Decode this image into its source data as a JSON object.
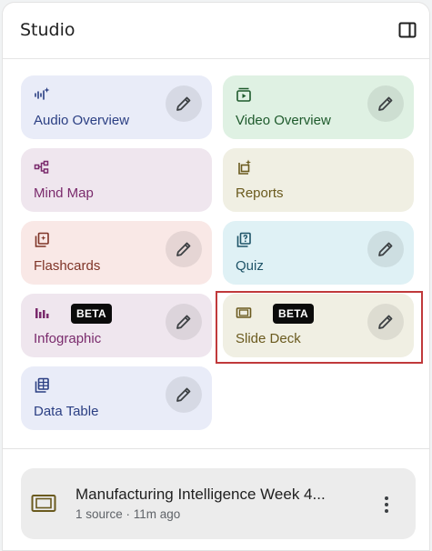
{
  "header": {
    "title": "Studio",
    "collapse_icon": "side-panel-icon"
  },
  "tools": [
    {
      "label": "Audio Overview",
      "icon": "audio-waveform-icon",
      "has_edit": true,
      "beta": ""
    },
    {
      "label": "Video Overview",
      "icon": "video-player-icon",
      "has_edit": true,
      "beta": ""
    },
    {
      "label": "Mind Map",
      "icon": "mind-map-icon",
      "has_edit": false,
      "beta": ""
    },
    {
      "label": "Reports",
      "icon": "reports-sparkle-icon",
      "has_edit": false,
      "beta": ""
    },
    {
      "label": "Flashcards",
      "icon": "flashcards-icon",
      "has_edit": true,
      "beta": ""
    },
    {
      "label": "Quiz",
      "icon": "quiz-icon",
      "has_edit": true,
      "beta": ""
    },
    {
      "label": "Infographic",
      "icon": "bar-chart-icon",
      "has_edit": true,
      "beta": "BETA"
    },
    {
      "label": "Slide Deck",
      "icon": "slides-icon",
      "has_edit": true,
      "beta": "BETA"
    },
    {
      "label": "Data Table",
      "icon": "table-icon",
      "has_edit": true,
      "beta": ""
    }
  ],
  "colors": {
    "audio": "#e9ecf8",
    "video": "#dff1e3",
    "mind_map": "#efe6ee",
    "reports": "#f0efe3",
    "flashcards": "#f9e8e6",
    "quiz": "#dff1f5",
    "infographic": "#efe6ee",
    "slide_deck": "#f0efe3",
    "data_table": "#e9ecf8",
    "highlight": "#c0393b"
  },
  "note": {
    "title": "Manufacturing Intelligence Week 4...",
    "meta": "1 source · 11m ago",
    "icon": "slides-icon",
    "more_icon": "more-vert-icon"
  }
}
